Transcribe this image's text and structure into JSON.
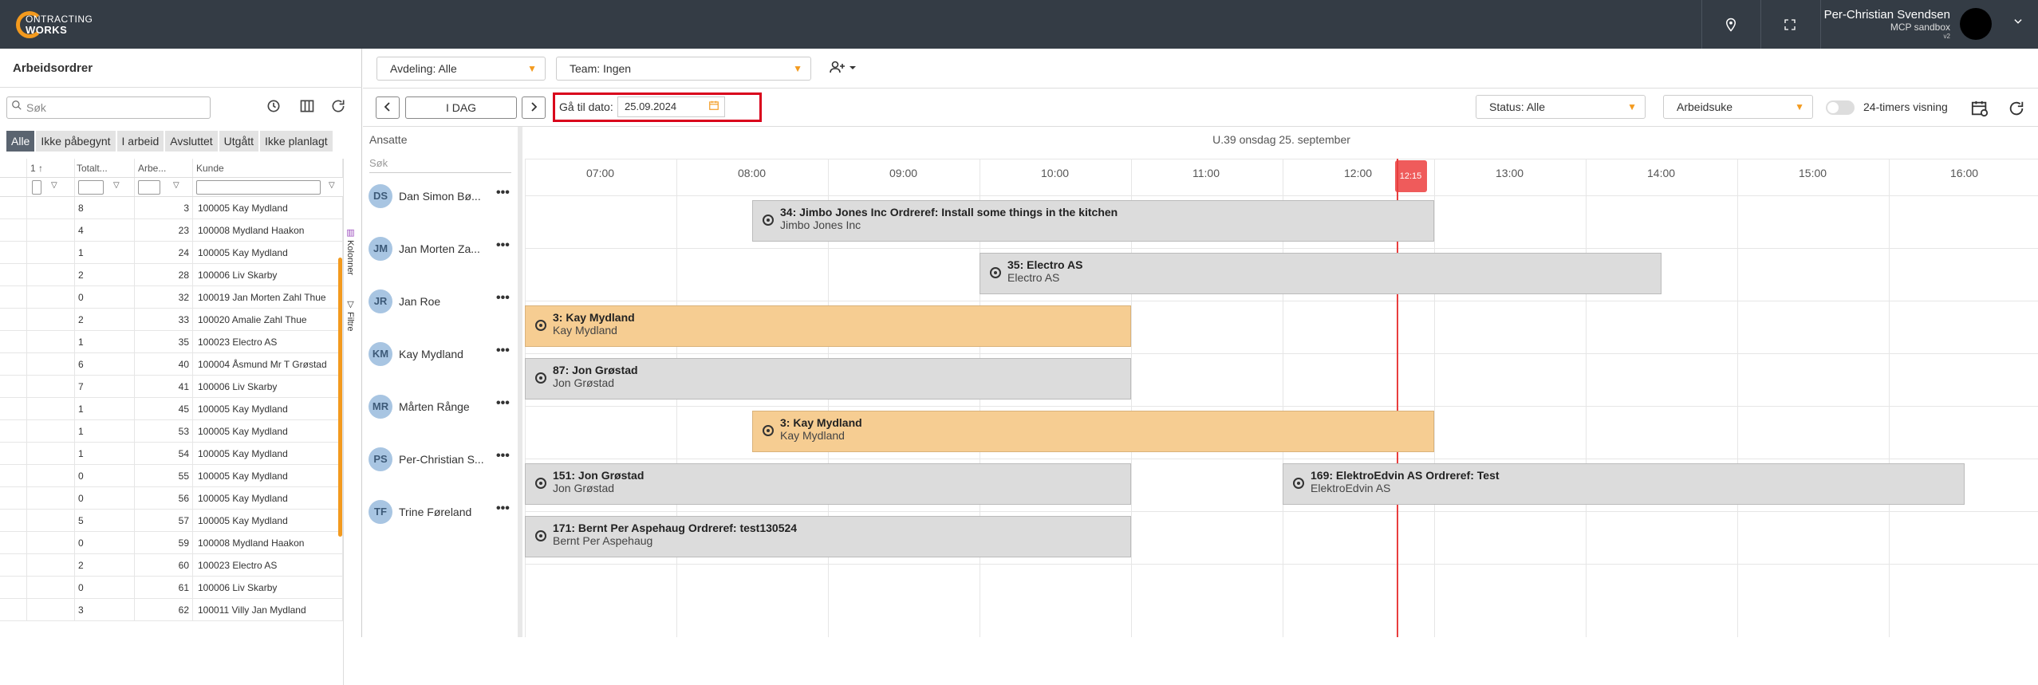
{
  "app": {
    "logo_line1": "ONTRACTING",
    "logo_line2": "WORKS",
    "user_name": "Per-Christian Svendsen",
    "user_sub": "MCP sandbox",
    "user_ver": "v2"
  },
  "left": {
    "title": "Arbeidsordrer",
    "search_placeholder": "Søk",
    "filters": [
      "Alle",
      "Ikke påbegynt",
      "I arbeid",
      "Avsluttet",
      "Utgått",
      "Ikke planlagt"
    ],
    "headers": [
      "1 ↑",
      "Totalt...",
      "Arbe...",
      "Kunde"
    ],
    "rows": [
      [
        "8",
        "3",
        "100005 Kay Mydland"
      ],
      [
        "4",
        "23",
        "100008 Mydland Haakon"
      ],
      [
        "1",
        "24",
        "100005 Kay Mydland"
      ],
      [
        "2",
        "28",
        "100006 Liv Skarby"
      ],
      [
        "0",
        "32",
        "100019 Jan Morten Zahl Thue"
      ],
      [
        "2",
        "33",
        "100020 Amalie Zahl Thue"
      ],
      [
        "1",
        "35",
        "100023 Electro AS"
      ],
      [
        "6",
        "40",
        "100004 Åsmund Mr T Grøstad"
      ],
      [
        "7",
        "41",
        "100006 Liv Skarby"
      ],
      [
        "1",
        "45",
        "100005 Kay Mydland"
      ],
      [
        "1",
        "53",
        "100005 Kay Mydland"
      ],
      [
        "1",
        "54",
        "100005 Kay Mydland"
      ],
      [
        "0",
        "55",
        "100005 Kay Mydland"
      ],
      [
        "0",
        "56",
        "100005 Kay Mydland"
      ],
      [
        "5",
        "57",
        "100005 Kay Mydland"
      ],
      [
        "0",
        "59",
        "100008 Mydland Haakon"
      ],
      [
        "2",
        "60",
        "100023 Electro AS"
      ],
      [
        "0",
        "61",
        "100006 Liv Skarby"
      ],
      [
        "3",
        "62",
        "100011 Villy Jan Mydland"
      ]
    ],
    "side_tab_columns": "Kolonner",
    "side_tab_filters": "Filtre"
  },
  "toolbar": {
    "avdeling_label": "Avdeling:",
    "avdeling_value": "Alle",
    "team_label": "Team:",
    "team_value": "Ingen",
    "today": "I DAG",
    "goto_label": "Gå til dato:",
    "goto_value": "25.09.2024",
    "status_label": "Status:",
    "status_value": "Alle",
    "view_value": "Arbeidsuke",
    "toggle_label": "24-timers visning"
  },
  "schedule": {
    "employees_header": "Ansatte",
    "employees_search": "Søk",
    "date_label": "U.39 onsdag 25. september",
    "hours": [
      "07:00",
      "08:00",
      "09:00",
      "10:00",
      "11:00",
      "12:00",
      "13:00",
      "14:00",
      "15:00",
      "16:00"
    ],
    "now_label": "12:15",
    "employees": [
      {
        "initials": "DS",
        "name": "Dan Simon Bø..."
      },
      {
        "initials": "JM",
        "name": "Jan Morten Za..."
      },
      {
        "initials": "JR",
        "name": "Jan Roe"
      },
      {
        "initials": "KM",
        "name": "Kay Mydland"
      },
      {
        "initials": "MR",
        "name": "Mårten Rånge"
      },
      {
        "initials": "PS",
        "name": "Per-Christian S..."
      },
      {
        "initials": "TF",
        "name": "Trine Føreland"
      }
    ],
    "jobs": [
      {
        "row": 0,
        "start": 8.0,
        "end": 12.5,
        "title": "34: Jimbo Jones Inc Ordreref: Install some things in the kitchen",
        "sub": "Jimbo Jones Inc",
        "color": "gray"
      },
      {
        "row": 1,
        "start": 9.5,
        "end": 14.0,
        "title": "35: Electro AS",
        "sub": "Electro AS",
        "color": "gray"
      },
      {
        "row": 2,
        "start": 6.5,
        "end": 10.5,
        "title": "3: Kay Mydland",
        "sub": "Kay Mydland",
        "color": "orange"
      },
      {
        "row": 3,
        "start": 6.5,
        "end": 10.5,
        "title": "87: Jon Grøstad",
        "sub": "Jon Grøstad",
        "color": "gray"
      },
      {
        "row": 4,
        "start": 8.0,
        "end": 12.5,
        "title": "3: Kay Mydland",
        "sub": "Kay Mydland",
        "color": "orange"
      },
      {
        "row": 5,
        "start": 6.5,
        "end": 10.5,
        "title": "151: Jon Grøstad",
        "sub": "Jon Grøstad",
        "color": "gray"
      },
      {
        "row": 5,
        "start": 11.5,
        "end": 16.0,
        "title": "169: ElektroEdvin AS Ordreref: Test",
        "sub": "ElektroEdvin AS",
        "color": "gray"
      },
      {
        "row": 6,
        "start": 6.5,
        "end": 10.5,
        "title": "171: Bernt Per Aspehaug Ordreref: test130524",
        "sub": "Bernt Per Aspehaug",
        "color": "gray"
      }
    ]
  }
}
